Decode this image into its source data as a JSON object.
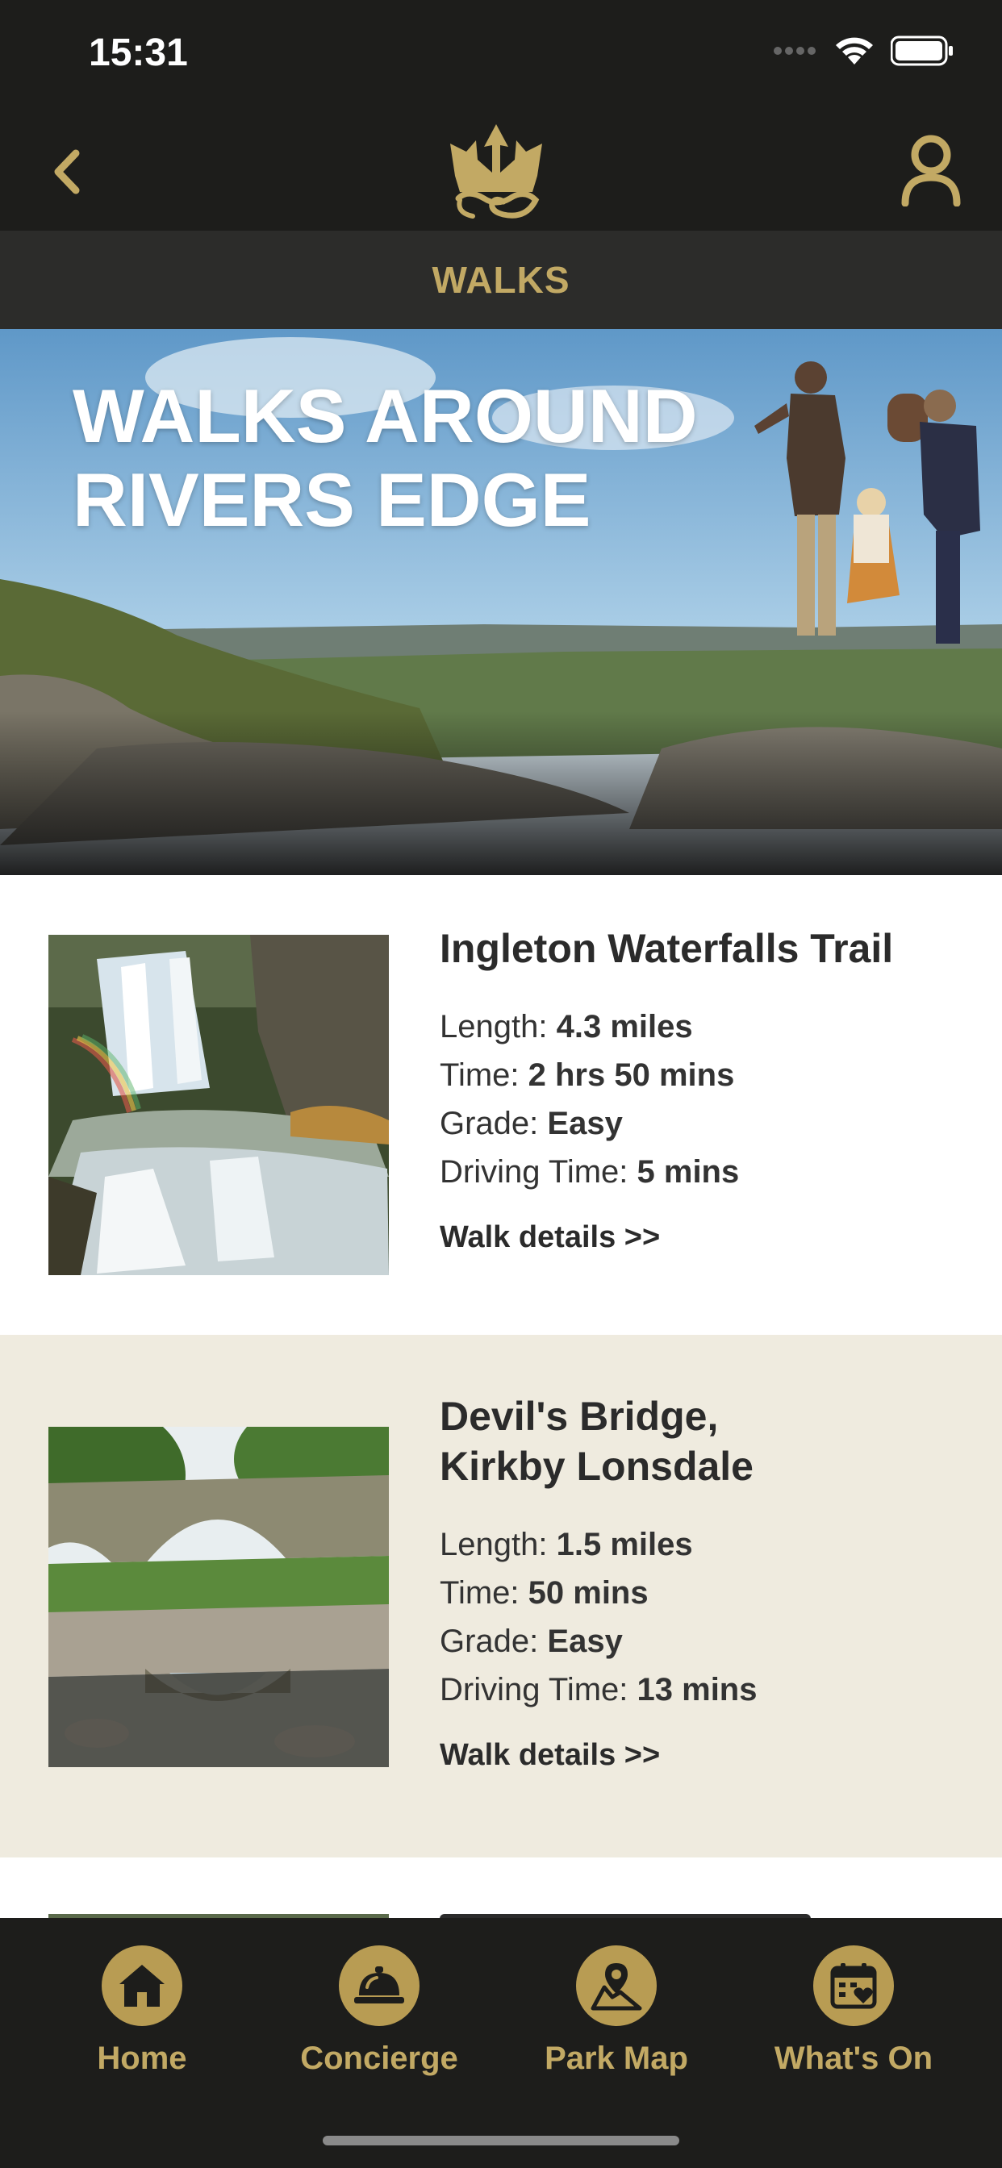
{
  "status": {
    "time": "15:31"
  },
  "header": {
    "title": "WALKS"
  },
  "hero": {
    "line1": "WALKS AROUND",
    "line2": "RIVERS EDGE"
  },
  "walks": [
    {
      "title_lines": [
        "Ingleton Waterfalls Trail"
      ],
      "length_label": "Length:",
      "length": "4.3 miles",
      "time_label": "Time:",
      "time": "2 hrs 50 mins",
      "grade_label": "Grade:",
      "grade": "Easy",
      "driving_label": "Driving Time:",
      "driving": "5 mins",
      "link": "Walk details >>"
    },
    {
      "title_lines": [
        "Devil's Bridge,",
        "Kirkby Lonsdale"
      ],
      "length_label": "Length:",
      "length": "1.5 miles",
      "time_label": "Time:",
      "time": "50 mins",
      "grade_label": "Grade:",
      "grade": "Easy",
      "driving_label": "Driving Time:",
      "driving": "13 mins",
      "link": "Walk details >>"
    }
  ],
  "tabs": [
    {
      "label": "Home",
      "icon": "home-icon"
    },
    {
      "label": "Concierge",
      "icon": "bell-icon"
    },
    {
      "label": "Park Map",
      "icon": "map-pin-icon"
    },
    {
      "label": "What's On",
      "icon": "calendar-heart-icon"
    }
  ],
  "colors": {
    "gold": "#c2a964",
    "dark": "#1d1d1b",
    "cream": "#efebdf"
  }
}
